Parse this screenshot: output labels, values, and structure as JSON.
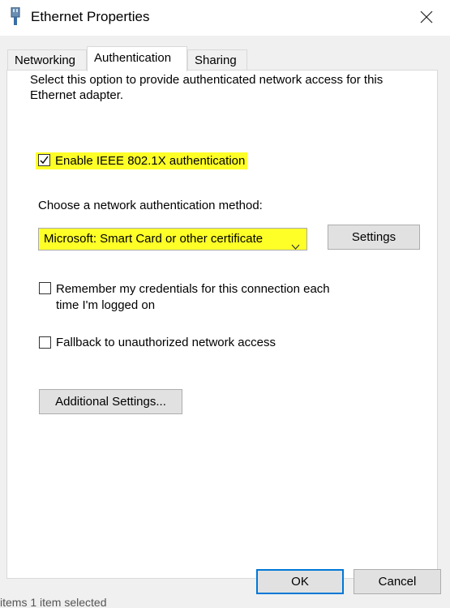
{
  "window": {
    "title": "Ethernet Properties",
    "close_icon": "close-icon"
  },
  "tabs": [
    {
      "label": "Networking",
      "active": false
    },
    {
      "label": "Authentication",
      "active": true
    },
    {
      "label": "Sharing",
      "active": false
    }
  ],
  "authentication": {
    "description": "Select this option to provide authenticated network access for this Ethernet adapter.",
    "enable_8021x": {
      "label": "Enable IEEE 802.1X authentication",
      "checked": true
    },
    "method_label": "Choose a network authentication method:",
    "method_select": {
      "value": "Microsoft: Smart Card or other certificate"
    },
    "settings_button": "Settings",
    "remember_credentials": {
      "label": "Remember my credentials for this connection each time I'm logged on",
      "checked": false
    },
    "fallback": {
      "label": "Fallback to unauthorized network access",
      "checked": false
    },
    "additional_settings_button": "Additional Settings..."
  },
  "footer": {
    "ok_button": "OK",
    "cancel_button": "Cancel"
  },
  "background_remnant": "items    1 item selected",
  "colors": {
    "highlight": "#ffff28",
    "accent": "#0078d7",
    "dialog_bg": "#f0f0f0"
  }
}
